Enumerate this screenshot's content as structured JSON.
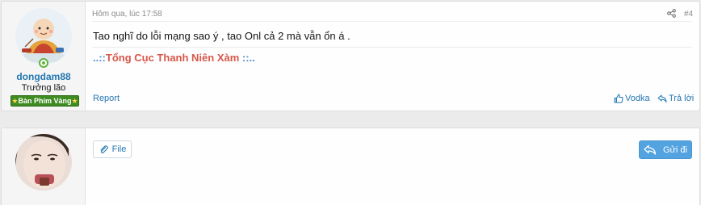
{
  "post": {
    "date": "Hôm qua, lúc 17:58",
    "number": "#4",
    "message": "Tao nghĩ do lỗi mạng sao ý , tao Onl cả 2 mà vẫn ổn á .",
    "signature": {
      "prefix": "..::",
      "text": "Tổng Cục Thanh Niên Xàm",
      "suffix": " ::.."
    },
    "actions": {
      "report": "Report",
      "like": "Vodka",
      "reply": "Trả lời"
    },
    "user": {
      "name": "dongdam88",
      "title": "Trưởng lão",
      "banner": "Bàn Phím Vàng",
      "banner_star": "★",
      "online": true
    }
  },
  "reply_box": {
    "file_label": "File",
    "send_label": "Gửi đi"
  },
  "colors": {
    "link": "#2577b1",
    "banner_green": "#3d8b21",
    "signature_red": "#d8574b",
    "signature_blue": "#4f8fd3",
    "send_blue": "#53a3e0"
  }
}
